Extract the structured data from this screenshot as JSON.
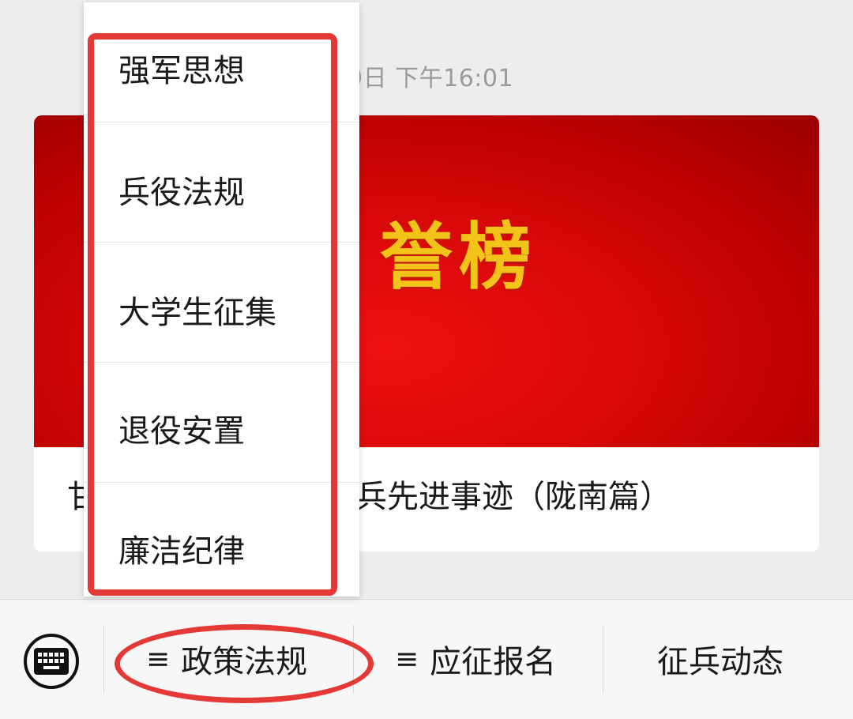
{
  "message": {
    "timestamp": "9日 下午16:01",
    "banner_text": "誉榜",
    "article_title_left": "甘",
    "article_title_right": "兵先进事迹（陇南篇）"
  },
  "popup_menu": {
    "items": [
      {
        "label": "强军思想"
      },
      {
        "label": "兵役法规"
      },
      {
        "label": "大学生征集"
      },
      {
        "label": "退役安置"
      },
      {
        "label": "廉洁纪律"
      }
    ]
  },
  "bottom_bar": {
    "keyboard_icon": "keyboard-icon",
    "menus": [
      {
        "label": "政策法规",
        "prefix": "≡"
      },
      {
        "label": "应征报名",
        "prefix": "≡"
      },
      {
        "label": "征兵动态",
        "prefix": ""
      }
    ]
  },
  "colors": {
    "annotation": "#e53935",
    "banner_red": "#d80808",
    "banner_gold": "#f2c318"
  }
}
